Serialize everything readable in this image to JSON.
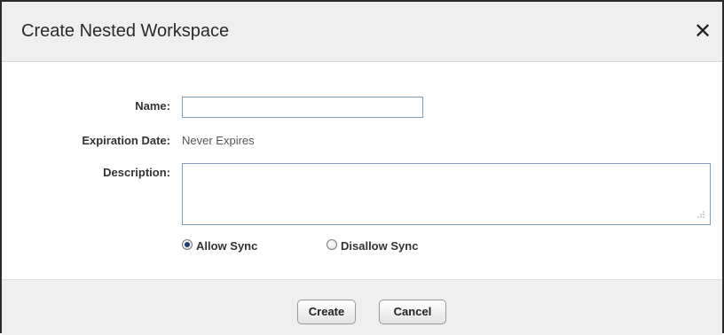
{
  "dialog": {
    "title": "Create Nested Workspace",
    "close_label": "✕"
  },
  "form": {
    "name_label": "Name:",
    "name_value": "",
    "expiration_label": "Expiration Date:",
    "expiration_value": "Never Expires",
    "description_label": "Description:",
    "description_value": "",
    "sync_options": [
      {
        "label": "Allow Sync",
        "checked": true
      },
      {
        "label": "Disallow Sync",
        "checked": false
      }
    ]
  },
  "footer": {
    "create_label": "Create",
    "cancel_label": "Cancel"
  }
}
